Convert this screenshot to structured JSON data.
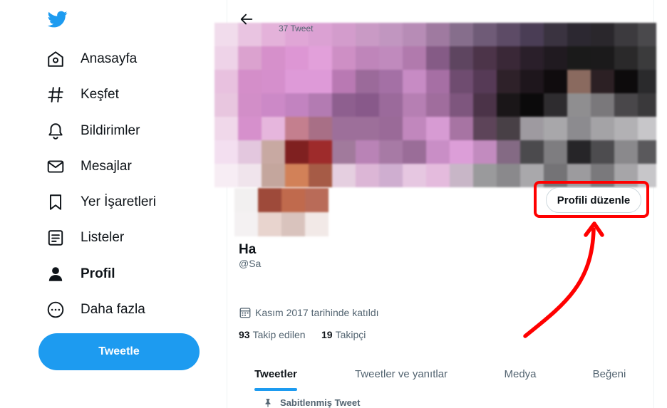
{
  "sidebar": {
    "items": [
      {
        "label": "Anasayfa",
        "icon": "home-icon"
      },
      {
        "label": "Keşfet",
        "icon": "hashtag-icon"
      },
      {
        "label": "Bildirimler",
        "icon": "bell-icon"
      },
      {
        "label": "Mesajlar",
        "icon": "envelope-icon"
      },
      {
        "label": "Yer İşaretleri",
        "icon": "bookmark-icon"
      },
      {
        "label": "Listeler",
        "icon": "list-icon"
      },
      {
        "label": "Profil",
        "icon": "person-icon",
        "active": true
      },
      {
        "label": "Daha fazla",
        "icon": "more-circle-icon"
      }
    ],
    "tweet_button": "Tweetle"
  },
  "profile": {
    "tweet_count": "37 Tweet",
    "edit_button": "Profili düzenle",
    "name": "Ha",
    "handle": "@Sa",
    "joined": "Kasım 2017 tarihinde katıldı",
    "following_count": "93",
    "following_label": "Takip edilen",
    "followers_count": "19",
    "followers_label": "Takipçi"
  },
  "tabs": [
    {
      "label": "Tweetler",
      "active": true
    },
    {
      "label": "Tweetler ve yanıtlar"
    },
    {
      "label": "Medya"
    },
    {
      "label": "Beğeni"
    }
  ],
  "pinned_label": "Sabitlenmiş Tweet",
  "colors": {
    "accent": "#1d9bf0",
    "annotation": "#ff0000"
  },
  "banner_colors": [
    "#f1dcec",
    "#e9c4e1",
    "#e4b2da",
    "#e0a6d6",
    "#dba1d3",
    "#d39ccc",
    "#c99ac5",
    "#c196c0",
    "#b78cb6",
    "#9f7aa0",
    "#866e8c",
    "#6f5b77",
    "#5d4b66",
    "#4a3d55",
    "#3a3340",
    "#2c2831",
    "#2a272c",
    "#3c3a3e",
    "#4a494c",
    "#eed3e8",
    "#dba2cf",
    "#d690cb",
    "#dd96d4",
    "#e2a0da",
    "#ce8fc5",
    "#bf85ba",
    "#c08abd",
    "#b17aad",
    "#855b86",
    "#5e4560",
    "#4c3449",
    "#3a2837",
    "#2a1f2a",
    "#201a20",
    "#1a1a1a",
    "#1b1a1b",
    "#2a292a",
    "#3b3b3c",
    "#e8c1df",
    "#d48ec9",
    "#d58fcc",
    "#de9ad8",
    "#de9ad8",
    "#b979b3",
    "#9b6a9a",
    "#a470a5",
    "#c78bc4",
    "#a66fa4",
    "#6f4c70",
    "#563a56",
    "#2e2129",
    "#1e161c",
    "#100c0e",
    "#8a6a5f",
    "#2c2024",
    "#0d0b0c",
    "#2a2a2c",
    "#e8c6df",
    "#d28ec8",
    "#cc89c7",
    "#c283c0",
    "#b37bb2",
    "#8e5f8f",
    "#88598a",
    "#9b6a9b",
    "#b67fb3",
    "#a06d9d",
    "#7e567e",
    "#4b3348",
    "#1a1618",
    "#0b0a0b",
    "#2e2c2f",
    "#8f8e90",
    "#7a787b",
    "#49474a",
    "#3a393b",
    "#f0d8ea",
    "#d690cc",
    "#e6b6dd",
    "#c47f8e",
    "#a86f86",
    "#9d6f9a",
    "#9d6f9a",
    "#9a6a98",
    "#c187bd",
    "#d79bd3",
    "#a774a3",
    "#5d4459",
    "#484046",
    "#9e9aa0",
    "#a8a7aa",
    "#8c8b8f",
    "#a4a3a6",
    "#b2b1b4",
    "#c7c6c9",
    "#f3dff0",
    "#e3c7de",
    "#c8a9a2",
    "#7f2020",
    "#9e2b2b",
    "#a17a9c",
    "#b983b6",
    "#a77aa5",
    "#9a6d98",
    "#c98ec6",
    "#dc9ed8",
    "#c28bbf",
    "#846a84",
    "#4b4a4d",
    "#7e7d80",
    "#262528",
    "#4d4c4f",
    "#8a898c",
    "#5a595c",
    "#f7edf4",
    "#f0e4ec",
    "#c4a69d",
    "#d28158",
    "#a65b46",
    "#e5cfe0",
    "#dcb6d6",
    "#cfaed0",
    "#e6c7e1",
    "#e4bbdd",
    "#c8b6c7",
    "#9a9a9c",
    "#8a898c",
    "#a9a8ab",
    "#747376",
    "#9c9b9e",
    "#7a797c",
    "#a6a5a8",
    "#c7c6c9"
  ],
  "avatar_colors": [
    "#f2f0f0",
    "#9e4a3a",
    "#c06a4d",
    "#b96b58",
    "#f4f1f2",
    "#e8d4ce",
    "#d9c3bd",
    "#f2e9e7"
  ]
}
